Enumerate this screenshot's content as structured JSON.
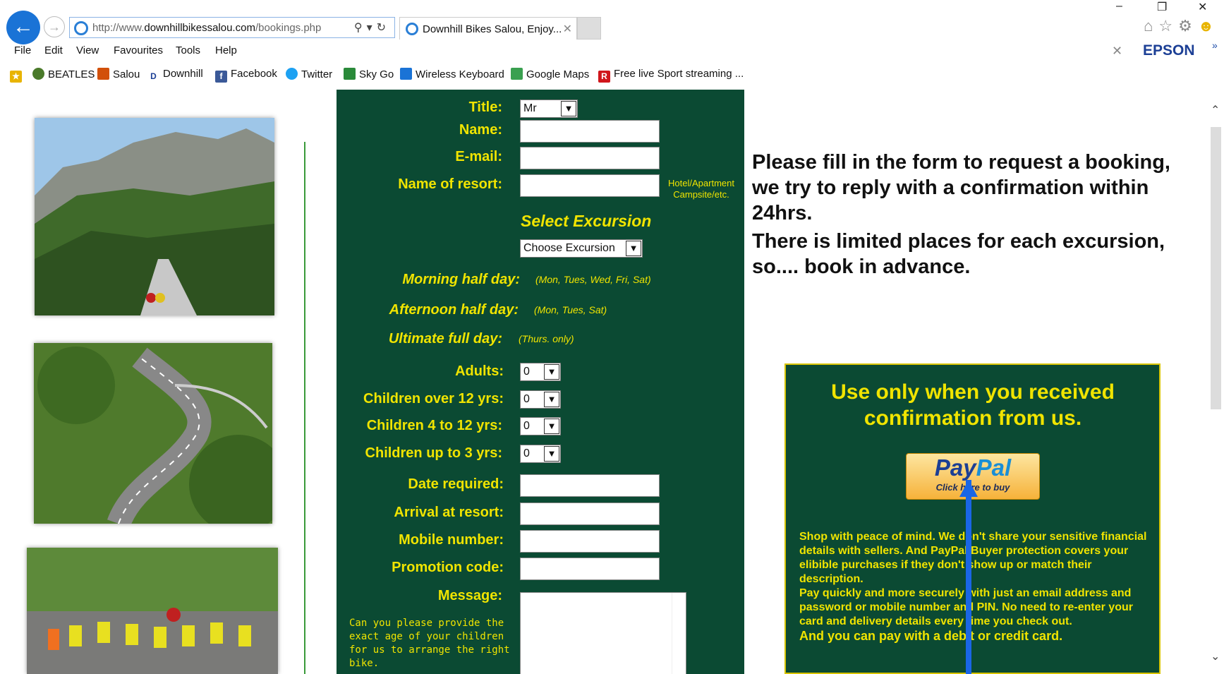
{
  "browser": {
    "url_prefix": "http://www.",
    "url_domain": "downhillbikessalou.com",
    "url_path": "/bookings.php",
    "tab_title": "Downhill Bikes Salou, Enjoy...",
    "menu": [
      "File",
      "Edit",
      "View",
      "Favourites",
      "Tools",
      "Help"
    ],
    "favourites": [
      "BEATLES",
      "Salou",
      "Downhill",
      "Facebook",
      "Twitter",
      "Sky Go",
      "Wireless Keyboard",
      "Google Maps",
      "Free live Sport streaming",
      "..."
    ],
    "toolbar_brand": "EPSON"
  },
  "form": {
    "title_label": "Title:",
    "title_value": "Mr",
    "name_label": "Name:",
    "email_label": "E-mail:",
    "resort_label": "Name of resort:",
    "resort_note": "Hotel/Apartment Campsite/etc.",
    "select_excursion": "Select Excursion",
    "excursion_value": "Choose Excursion",
    "morning_label": "Morning half day:",
    "morning_days": "(Mon, Tues, Wed, Fri, Sat)",
    "afternoon_label": "Afternoon half day:",
    "afternoon_days": "(Mon, Tues, Sat)",
    "ultimate_label": "Ultimate full day:",
    "ultimate_days": "(Thurs. only)",
    "adults_label": "Adults:",
    "adults_value": "0",
    "over12_label": "Children over 12 yrs:",
    "over12_value": "0",
    "kids4to12_label": "Children 4 to 12 yrs:",
    "kids4to12_value": "0",
    "upto3_label": "Children up to 3 yrs:",
    "upto3_value": "0",
    "date_label": "Date required:",
    "arrival_label": "Arrival at resort:",
    "mobile_label": "Mobile number:",
    "promo_label": "Promotion code:",
    "message_label": "Message:",
    "message_note": "Can you please provide the exact age of your children for us to arrange the right bike."
  },
  "info": {
    "para1": "Please fill in the form to request a booking, we try to reply with a confirmation within 24hrs.",
    "para2": "There is limited places for each excursion, so.... book in advance."
  },
  "paypal": {
    "heading": "Use only when you received confirmation from us.",
    "brand_pay": "Pay",
    "brand_pal": "Pal",
    "button_caption": "Click here to buy",
    "text1": "Shop with peace of mind. We don't share your sensitive financial details with sellers. And PayPal Buyer protection covers your elibible purchases if they don't show up or match their description.",
    "text2": "Pay quickly and more securely with just an email address and password or mobile number and PIN. No need to re-enter your card and delivery details every time you check out.",
    "text3": "And you can pay with a debit or credit card."
  },
  "colors": {
    "form_bg": "#0b4a33",
    "label_yellow": "#f0e400",
    "arrow_blue": "#1a66e6"
  }
}
